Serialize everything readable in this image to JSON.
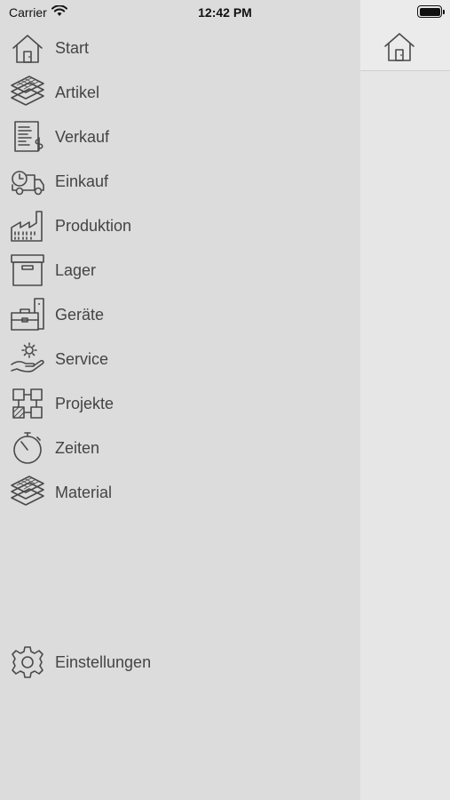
{
  "status_bar": {
    "carrier": "Carrier",
    "time": "12:42 PM"
  },
  "menu": [
    {
      "label": "Start",
      "icon": "house-icon"
    },
    {
      "label": "Artikel",
      "icon": "layers-icon"
    },
    {
      "label": "Verkauf",
      "icon": "invoice-icon"
    },
    {
      "label": "Einkauf",
      "icon": "delivery-truck-icon"
    },
    {
      "label": "Produktion",
      "icon": "factory-icon"
    },
    {
      "label": "Lager",
      "icon": "storage-box-icon"
    },
    {
      "label": "Geräte",
      "icon": "toolbox-icon"
    },
    {
      "label": "Service",
      "icon": "service-hand-icon"
    },
    {
      "label": "Projekte",
      "icon": "project-blocks-icon"
    },
    {
      "label": "Zeiten",
      "icon": "stopwatch-icon"
    },
    {
      "label": "Material",
      "icon": "layers-icon"
    }
  ],
  "settings": {
    "label": "Einstellungen",
    "icon": "gear-icon"
  },
  "detail": {
    "header_icon": "house-icon"
  },
  "colors": {
    "sidebar_bg": "#dcdcdc",
    "detail_bg": "#e6e6e6",
    "icon_stroke": "#4a4a4a",
    "label_text": "#444444"
  }
}
